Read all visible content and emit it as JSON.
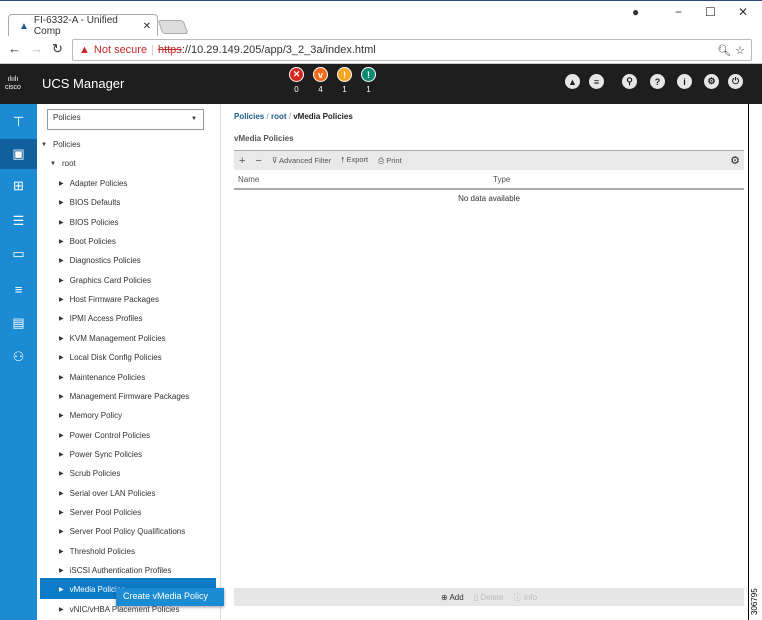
{
  "browser": {
    "tab_title": "FI-6332-A - Unified Comp",
    "not_secure": "Not secure",
    "url_scheme": "https",
    "url_rest": "://10.29.149.205/app/3_2_3a/index.html"
  },
  "header": {
    "logo": "cisco",
    "title": "UCS Manager",
    "faults": [
      {
        "icon": "critical-icon",
        "count": "0",
        "color": "#d9261c"
      },
      {
        "icon": "major-icon",
        "count": "4",
        "color": "#f26b1d"
      },
      {
        "icon": "minor-icon",
        "count": "1",
        "color": "#f5a623"
      },
      {
        "icon": "warning-icon",
        "count": "1",
        "color": "#0c8a6e"
      }
    ]
  },
  "tree": {
    "select_value": "Policies",
    "root_label": "Policies",
    "sub_label": "root",
    "items": [
      "Adapter Policies",
      "BIOS Defaults",
      "BIOS Policies",
      "Boot Policies",
      "Diagnostics Policies",
      "Graphics Card Policies",
      "Host Firmware Packages",
      "IPMI Access Profiles",
      "KVM Management Policies",
      "Local Disk Config Policies",
      "Maintenance Policies",
      "Management Firmware Packages",
      "Memory Policy",
      "Power Control Policies",
      "Power Sync Policies",
      "Scrub Policies",
      "Serial over LAN Policies",
      "Server Pool Policies",
      "Server Pool Policy Qualifications",
      "Threshold Policies",
      "iSCSI Authentication Profiles",
      "vMedia Policies",
      "vNIC/vHBA Placement Policies"
    ],
    "tooltip": "Create vMedia Policy"
  },
  "main": {
    "breadcrumb": [
      "Policies",
      "root",
      "vMedia Policies"
    ],
    "title": "vMedia Policies",
    "toolbar": {
      "add": "+",
      "remove": "−",
      "filter": "Advanced Filter",
      "export": "Export",
      "print": "Print"
    },
    "columns": [
      "Name",
      "Type"
    ],
    "empty": "No data available",
    "footer": {
      "add": "Add",
      "delete": "Delete",
      "info": "Info"
    }
  },
  "watermark": "306795"
}
